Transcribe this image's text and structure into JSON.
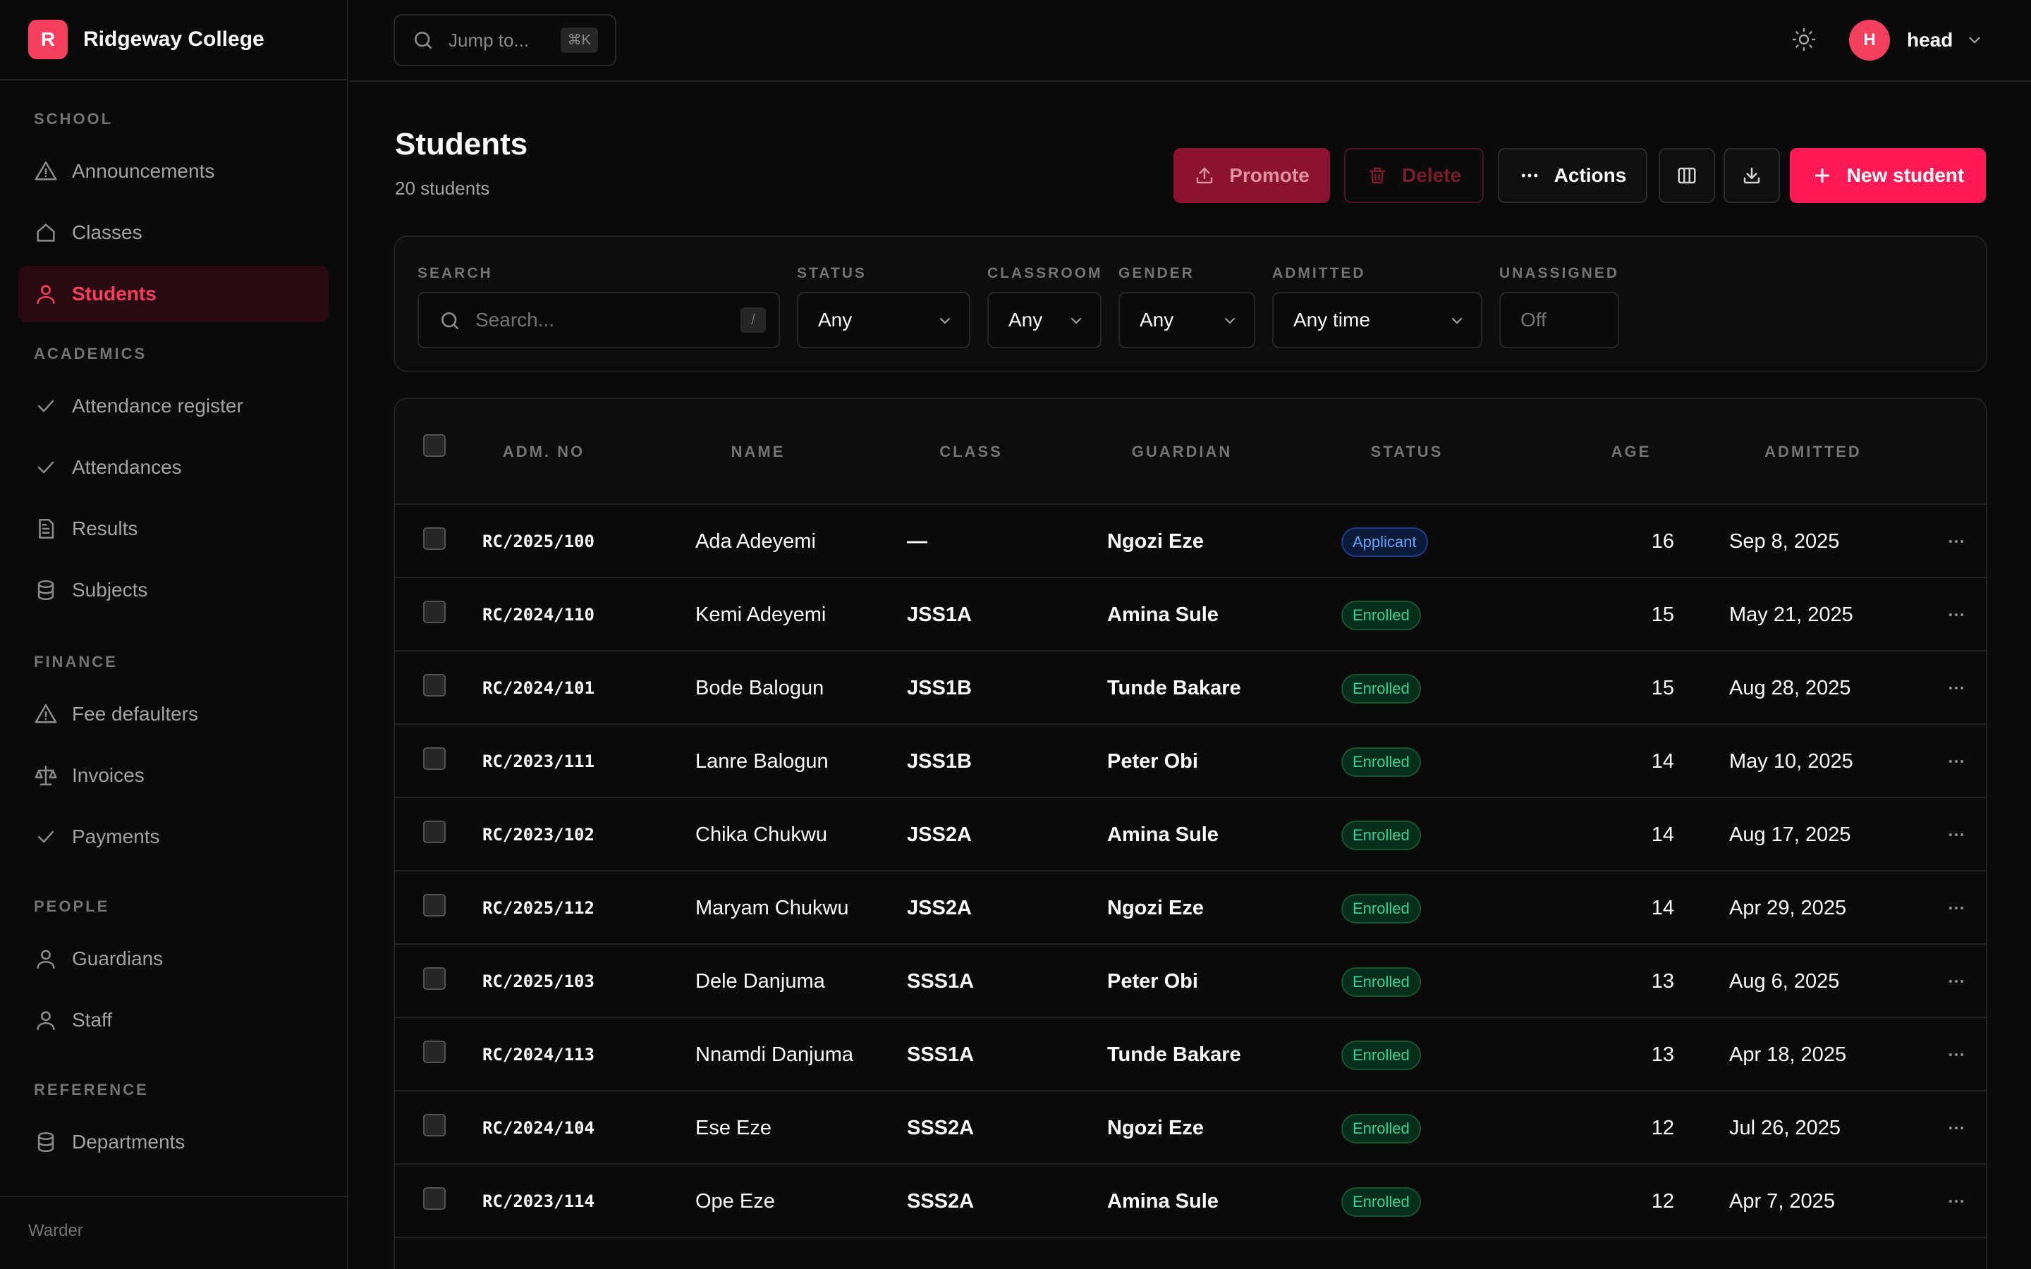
{
  "app": {
    "logo_letter": "R",
    "name": "Ridgeway College"
  },
  "sidebar": {
    "sections": [
      {
        "title": "SCHOOL",
        "items": [
          {
            "label": "Announcements",
            "icon": "alert-triangle-icon"
          },
          {
            "label": "Classes",
            "icon": "home-icon"
          },
          {
            "label": "Students",
            "icon": "user-icon",
            "active": true
          }
        ]
      },
      {
        "title": "ACADEMICS",
        "items": [
          {
            "label": "Attendance register",
            "icon": "check-icon"
          },
          {
            "label": "Attendances",
            "icon": "check-icon"
          },
          {
            "label": "Results",
            "icon": "file-text-icon"
          },
          {
            "label": "Subjects",
            "icon": "database-icon"
          }
        ]
      },
      {
        "title": "FINANCE",
        "items": [
          {
            "label": "Fee defaulters",
            "icon": "alert-triangle-icon"
          },
          {
            "label": "Invoices",
            "icon": "scale-icon"
          },
          {
            "label": "Payments",
            "icon": "check-icon"
          }
        ]
      },
      {
        "title": "PEOPLE",
        "items": [
          {
            "label": "Guardians",
            "icon": "user-icon"
          },
          {
            "label": "Staff",
            "icon": "user-icon"
          }
        ]
      },
      {
        "title": "REFERENCE",
        "items": [
          {
            "label": "Departments",
            "icon": "database-icon"
          }
        ]
      }
    ],
    "footer": "Warder"
  },
  "topbar": {
    "jump_placeholder": "Jump to...",
    "jump_shortcut": "⌘K",
    "user": {
      "initial": "H",
      "name": "head"
    }
  },
  "page": {
    "title": "Students",
    "subtitle": "20 students",
    "buttons": {
      "promote": "Promote",
      "delete": "Delete",
      "actions": "Actions",
      "new": "New student"
    }
  },
  "filters": {
    "search": {
      "label": "SEARCH",
      "placeholder": "Search...",
      "shortcut": "/"
    },
    "status": {
      "label": "STATUS",
      "value": "Any"
    },
    "classroom": {
      "label": "CLASSROOM",
      "value": "Any"
    },
    "gender": {
      "label": "GENDER",
      "value": "Any"
    },
    "admitted": {
      "label": "ADMITTED",
      "value": "Any time"
    },
    "unassigned": {
      "label": "UNASSIGNED",
      "value": "Off"
    }
  },
  "table": {
    "columns": {
      "adm": "ADM. NO",
      "name": "NAME",
      "class": "CLASS",
      "guardian": "GUARDIAN",
      "status": "STATUS",
      "age": "AGE",
      "admitted": "ADMITTED"
    },
    "rows": [
      {
        "adm": "RC/2025/100",
        "name": "Ada Adeyemi",
        "class": "—",
        "guardian": "Ngozi Eze",
        "status": "Applicant",
        "age": "16",
        "admitted": "Sep 8, 2025"
      },
      {
        "adm": "RC/2024/110",
        "name": "Kemi Adeyemi",
        "class": "JSS1A",
        "guardian": "Amina Sule",
        "status": "Enrolled",
        "age": "15",
        "admitted": "May 21, 2025"
      },
      {
        "adm": "RC/2024/101",
        "name": "Bode Balogun",
        "class": "JSS1B",
        "guardian": "Tunde Bakare",
        "status": "Enrolled",
        "age": "15",
        "admitted": "Aug 28, 2025"
      },
      {
        "adm": "RC/2023/111",
        "name": "Lanre Balogun",
        "class": "JSS1B",
        "guardian": "Peter Obi",
        "status": "Enrolled",
        "age": "14",
        "admitted": "May 10, 2025"
      },
      {
        "adm": "RC/2023/102",
        "name": "Chika Chukwu",
        "class": "JSS2A",
        "guardian": "Amina Sule",
        "status": "Enrolled",
        "age": "14",
        "admitted": "Aug 17, 2025"
      },
      {
        "adm": "RC/2025/112",
        "name": "Maryam Chukwu",
        "class": "JSS2A",
        "guardian": "Ngozi Eze",
        "status": "Enrolled",
        "age": "14",
        "admitted": "Apr 29, 2025"
      },
      {
        "adm": "RC/2025/103",
        "name": "Dele Danjuma",
        "class": "SSS1A",
        "guardian": "Peter Obi",
        "status": "Enrolled",
        "age": "13",
        "admitted": "Aug 6, 2025"
      },
      {
        "adm": "RC/2024/113",
        "name": "Nnamdi Danjuma",
        "class": "SSS1A",
        "guardian": "Tunde Bakare",
        "status": "Enrolled",
        "age": "13",
        "admitted": "Apr 18, 2025"
      },
      {
        "adm": "RC/2024/104",
        "name": "Ese Eze",
        "class": "SSS2A",
        "guardian": "Ngozi Eze",
        "status": "Enrolled",
        "age": "12",
        "admitted": "Jul 26, 2025"
      },
      {
        "adm": "RC/2023/114",
        "name": "Ope Eze",
        "class": "SSS2A",
        "guardian": "Amina Sule",
        "status": "Enrolled",
        "age": "12",
        "admitted": "Apr 7, 2025"
      }
    ]
  },
  "colors": {
    "accent": "#f43f5e",
    "primary_button": "#ff1a55",
    "background": "#0a0a0a",
    "enrolled": "#34d399",
    "applicant": "#60a5fa"
  }
}
